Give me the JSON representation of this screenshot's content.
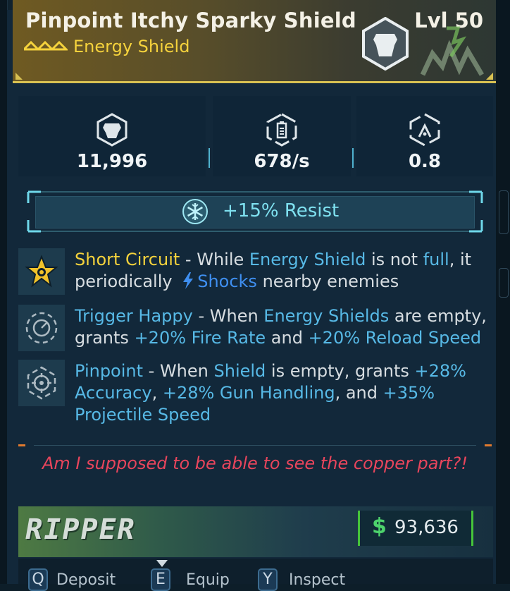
{
  "item": {
    "name": "Pinpoint Itchy Sparky Shield",
    "level": "Lvl 50",
    "type": "Energy Shield",
    "rarity_color": "#f5d23c"
  },
  "stats": [
    {
      "icon": "shield-capacity-icon",
      "value": "11,996"
    },
    {
      "icon": "recharge-rate-icon",
      "value": "678/s"
    },
    {
      "icon": "recharge-delay-icon",
      "value": "0.8"
    }
  ],
  "resist": {
    "icon": "cryo-snowflake-icon",
    "text": "+15% Resist"
  },
  "perks": [
    {
      "icon": "star-burst-icon",
      "name": "Short Circuit",
      "parts": [
        " - While ",
        "Energy Shield",
        " is not ",
        "full",
        ", it periodically ",
        "Shocks",
        " nearby enemies"
      ]
    },
    {
      "icon": "trigger-dial-icon",
      "name": "Trigger Happy",
      "parts": [
        " - When ",
        "Energy Shields",
        " are empty, grants ",
        "+20% Fire Rate",
        " and ",
        "+20% Reload Speed"
      ]
    },
    {
      "icon": "crosshair-icon",
      "name": "Pinpoint",
      "parts": [
        " - When ",
        "Shield",
        " is empty, grants ",
        "+28% Accuracy",
        ", ",
        "+28% Gun Handling",
        ", and ",
        "+35% Projectile Speed"
      ]
    }
  ],
  "flavor_text": "Am I supposed to be able to see the copper part?!",
  "manufacturer": "RIPPER",
  "price": {
    "symbol": "$",
    "value": "93,636"
  },
  "controls": [
    {
      "key": "Q",
      "label": "Deposit"
    },
    {
      "key": "E",
      "label": "Equip"
    },
    {
      "key": "Y",
      "label": "Inspect"
    }
  ]
}
